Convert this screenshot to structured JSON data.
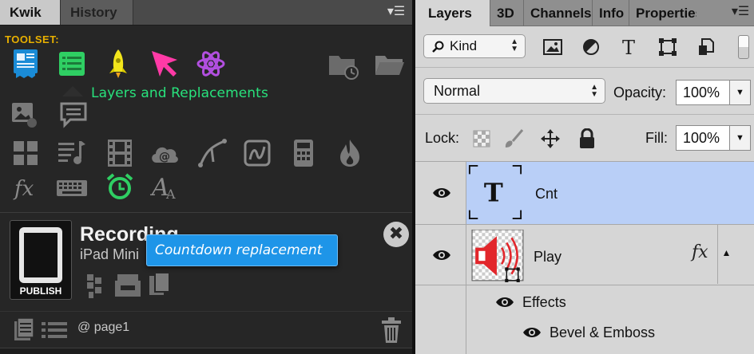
{
  "kwik": {
    "tabs": [
      "Kwik",
      "History"
    ],
    "toolset_label": "TOOLSET:",
    "layers_tip": "Layers and Replacements",
    "project": {
      "title": "Recording",
      "device": "iPad Mini",
      "publish_label": "PUBLISH"
    },
    "tooltip": "Countdown replacement",
    "close_glyph": "✖",
    "page_label": "@ page1"
  },
  "photoshop": {
    "tabs": [
      "Layers",
      "3D",
      "Channels",
      "Info",
      "Properties"
    ],
    "filter_kind": "Kind",
    "blend_mode": "Normal",
    "opacity_label": "Opacity:",
    "opacity_value": "100%",
    "lock_label": "Lock:",
    "fill_label": "Fill:",
    "fill_value": "100%",
    "layers": [
      {
        "name": "Cnt",
        "selected": true
      },
      {
        "name": "Play",
        "selected": false,
        "fx": "fx"
      }
    ],
    "effects_label": "Effects",
    "effect_items": [
      "Bevel & Emboss"
    ]
  },
  "colors": {
    "toolset_yellow": "#e8b000",
    "tip_green": "#28e27c",
    "tooltip_blue": "#1e95e8",
    "selection_blue": "#b9cff7"
  }
}
